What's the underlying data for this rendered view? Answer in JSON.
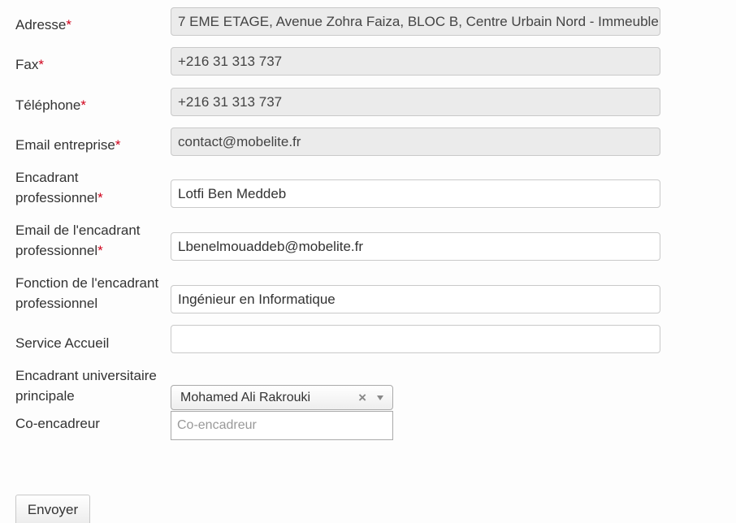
{
  "fields": {
    "adresse": {
      "label": "Adresse",
      "required": "*",
      "value": "7 EME ETAGE, Avenue Zohra Faiza, BLOC B, Centre Urbain Nord - Immeuble (",
      "readonly": true
    },
    "fax": {
      "label": "Fax",
      "required": "*",
      "value": "+216 31 313 737",
      "readonly": true
    },
    "telephone": {
      "label": "Téléphone",
      "required": "*",
      "value": "+216 31 313 737",
      "readonly": true
    },
    "email_entreprise": {
      "label": "Email entreprise",
      "required": "*",
      "value": "contact@mobelite.fr",
      "readonly": true
    },
    "encadrant_pro": {
      "label_line1": "Encadrant",
      "label_line2": "professionnel",
      "required": "*",
      "value": "Lotfi Ben Meddeb"
    },
    "email_encadrant": {
      "label_line1": "Email de l'encadrant",
      "label_line2": "professionnel",
      "required": "*",
      "value": "Lbenelmouaddeb@mobelite.fr"
    },
    "fonction_encadrant": {
      "label_line1": "Fonction de l'encadrant",
      "label_line2": "professionnel",
      "value": "Ingénieur en Informatique"
    },
    "service_accueil": {
      "label": "Service Accueil",
      "value": ""
    },
    "encadrant_univ": {
      "label_line1": "Encadrant universitaire",
      "label_line2": "principale",
      "selected": "Mohamed Ali Rakrouki",
      "clear_glyph": "×"
    },
    "co_encadreur": {
      "label": "Co-encadreur",
      "placeholder": "Co-encadreur"
    }
  },
  "submit": {
    "label": "Envoyer"
  }
}
